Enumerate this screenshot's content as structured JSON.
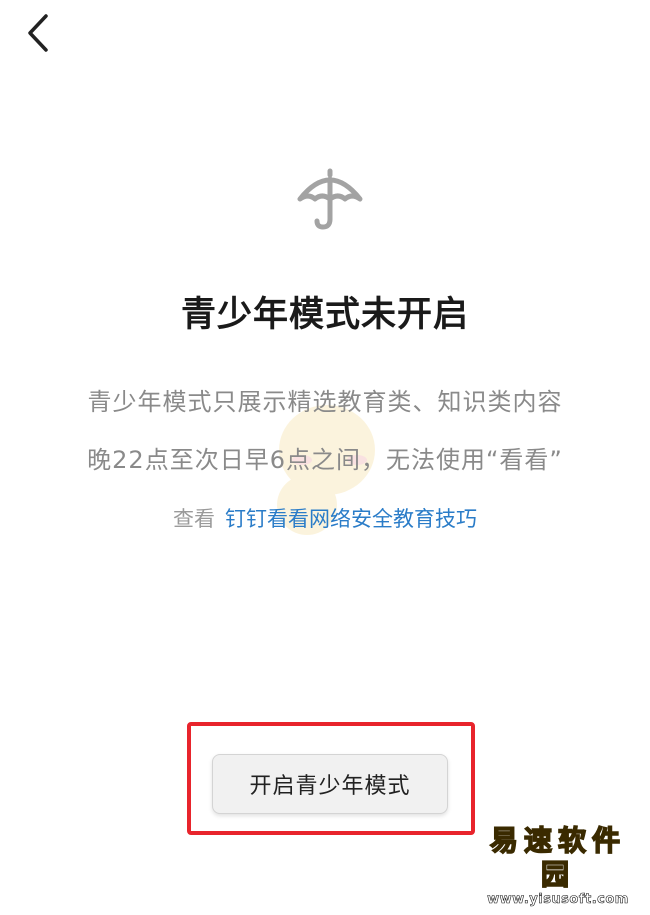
{
  "header": {
    "back_icon": "chevron-left-icon"
  },
  "main": {
    "icon": "umbrella-icon",
    "title": "青少年模式未开启",
    "description_line1": "青少年模式只展示精选教育类、知识类内容",
    "description_line2": "晚22点至次日早6点之间，无法使用“看看”",
    "link_prefix": "查看",
    "link_text": "钉钉看看网络安全教育技巧"
  },
  "actions": {
    "enable_button_label": "开启青少年模式"
  },
  "watermark": {
    "name": "易速软件园",
    "url": "www.yisusoft.com"
  },
  "colors": {
    "link": "#2a7cc8",
    "highlight_border": "#e8242c",
    "title": "#1a1a1a",
    "description": "#8a8a8a"
  }
}
